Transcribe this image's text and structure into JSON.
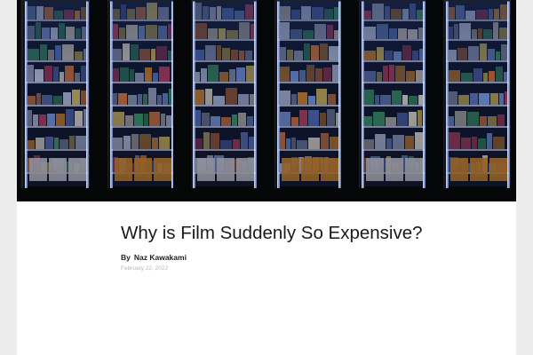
{
  "colors": {
    "page_background": "#ececec",
    "article_background": "#ffffff",
    "hero_background": "#050608",
    "title_color": "#1a1a1a",
    "date_color": "#b8b8b8"
  },
  "hero": {
    "icon": "film-refrigerator-photo",
    "description_visible": false
  },
  "article": {
    "title": "Why is Film Suddenly So Expensive?",
    "by_label": "By",
    "author": "Naz Kawakami",
    "date": "February 22, 2022"
  }
}
